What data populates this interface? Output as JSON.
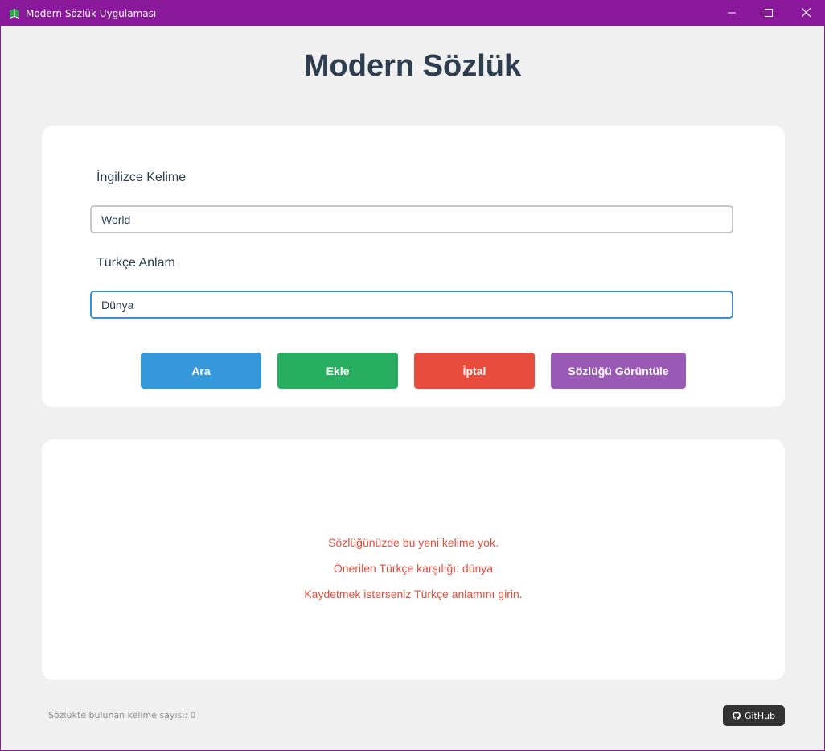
{
  "window": {
    "title": "Modern Sözlük Uygulaması",
    "controls": [
      "minimize-icon",
      "maximize-icon",
      "close-icon"
    ],
    "titlebar_color": "#8a189a"
  },
  "header": {
    "title": "Modern Sözlük"
  },
  "form": {
    "english_label": "İngilizce Kelime",
    "english_value": "World",
    "turkish_label": "Türkçe Anlam",
    "turkish_value": "Dünya"
  },
  "buttons": {
    "search_label": "Ara",
    "add_label": "Ekle",
    "cancel_label": "İptal",
    "view_label": "Sözlüğü Görüntüle",
    "colors": {
      "search": "#3498db",
      "add": "#27ae60",
      "cancel": "#e74c3c",
      "view": "#9b59b6"
    }
  },
  "result": {
    "lines": [
      "Sözlüğünüzde bu yeni kelime yok.",
      "Önerilen Türkçe karşılığı: dünya",
      "Kaydetmek isterseniz Türkçe anlamını girin."
    ],
    "color": "#e74c3c"
  },
  "footer": {
    "count_text": "Sözlükte bulunan kelime sayısı: 0",
    "github_label": "GitHub"
  }
}
